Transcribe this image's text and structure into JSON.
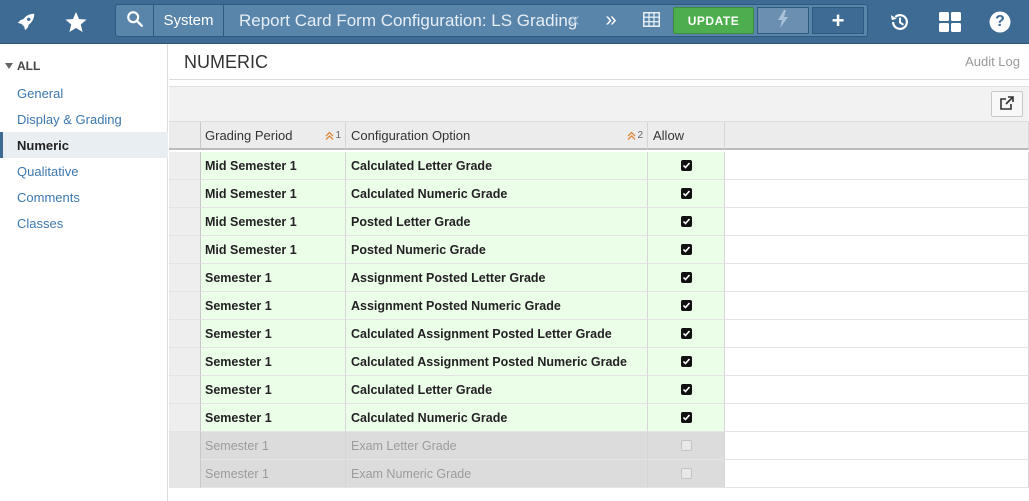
{
  "topbar": {
    "rocket_icon": "rocket-icon",
    "star_icon": "star-icon",
    "search_icon": "search-icon",
    "breadcrumb_root": "System",
    "page_title": "Report Card Form Configuration: LS Grading",
    "prev_glyph": "«",
    "next_glyph": "»",
    "update_label": "UPDATE",
    "plus_glyph": "+",
    "history_icon": "history-icon",
    "apps_icon": "apps-grid-icon",
    "help_glyph": "?",
    "bar_color": "#3d6b94",
    "update_color": "#4cae4c"
  },
  "sidebar": {
    "all_label": "ALL",
    "items": [
      {
        "label": "General"
      },
      {
        "label": "Display & Grading"
      },
      {
        "label": "Numeric"
      },
      {
        "label": "Qualitative"
      },
      {
        "label": "Comments"
      },
      {
        "label": "Classes"
      }
    ],
    "active_item": "Numeric"
  },
  "main": {
    "section_title": "NUMERIC",
    "audit_log": "Audit Log",
    "table": {
      "headers": {
        "period": "Grading Period",
        "period_sort": "1",
        "option": "Configuration Option",
        "option_sort": "2",
        "allow": "Allow"
      },
      "rows": [
        {
          "period": "Mid Semester 1",
          "option": "Calculated Letter Grade",
          "allow": true
        },
        {
          "period": "Mid Semester 1",
          "option": "Calculated Numeric Grade",
          "allow": true
        },
        {
          "period": "Mid Semester 1",
          "option": "Posted Letter Grade",
          "allow": true
        },
        {
          "period": "Mid Semester 1",
          "option": "Posted Numeric Grade",
          "allow": true
        },
        {
          "period": "Semester 1",
          "option": "Assignment Posted Letter Grade",
          "allow": true
        },
        {
          "period": "Semester 1",
          "option": "Assignment Posted Numeric Grade",
          "allow": true
        },
        {
          "period": "Semester 1",
          "option": "Calculated Assignment Posted Letter Grade",
          "allow": true
        },
        {
          "period": "Semester 1",
          "option": "Calculated Assignment Posted Numeric Grade",
          "allow": true
        },
        {
          "period": "Semester 1",
          "option": "Calculated Letter Grade",
          "allow": true
        },
        {
          "period": "Semester 1",
          "option": "Calculated Numeric Grade",
          "allow": true
        },
        {
          "period": "Semester 1",
          "option": "Exam Letter Grade",
          "allow": false
        },
        {
          "period": "Semester 1",
          "option": "Exam Numeric Grade",
          "allow": false
        }
      ]
    }
  }
}
